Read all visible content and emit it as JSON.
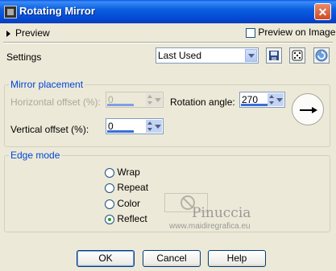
{
  "window": {
    "title": "Rotating Mirror",
    "close_glyph": "✕"
  },
  "preview": {
    "toggle_label": "Preview",
    "preview_on_image_label": "Preview on Image",
    "preview_on_image_checked": false
  },
  "settings": {
    "label": "Settings",
    "preset_value": "Last Used"
  },
  "toolbar_icons": [
    "save-preset-icon",
    "randomize-dice-icon",
    "reset-default-icon"
  ],
  "mirror_placement": {
    "group_label": "Mirror placement",
    "horizontal_offset": {
      "label": "Horizontal offset (%):",
      "value": "0",
      "enabled": false
    },
    "vertical_offset": {
      "label": "Vertical offset (%):",
      "value": "0"
    },
    "rotation_angle": {
      "label": "Rotation angle:",
      "value": "270"
    }
  },
  "edge_mode": {
    "group_label": "Edge mode",
    "options": [
      {
        "label": "Wrap",
        "checked": false
      },
      {
        "label": "Repeat",
        "checked": false
      },
      {
        "label": "Color",
        "checked": false
      },
      {
        "label": "Reflect",
        "checked": true
      }
    ]
  },
  "watermark": {
    "name": "Pinuccia",
    "url": "www.maidiregrafica.eu"
  },
  "buttons": {
    "ok": "OK",
    "cancel": "Cancel",
    "help": "Help"
  },
  "colors": {
    "title_bar": "#0a5fe0",
    "group_label": "#0046d5",
    "dialog_bg": "#ece9d8"
  }
}
